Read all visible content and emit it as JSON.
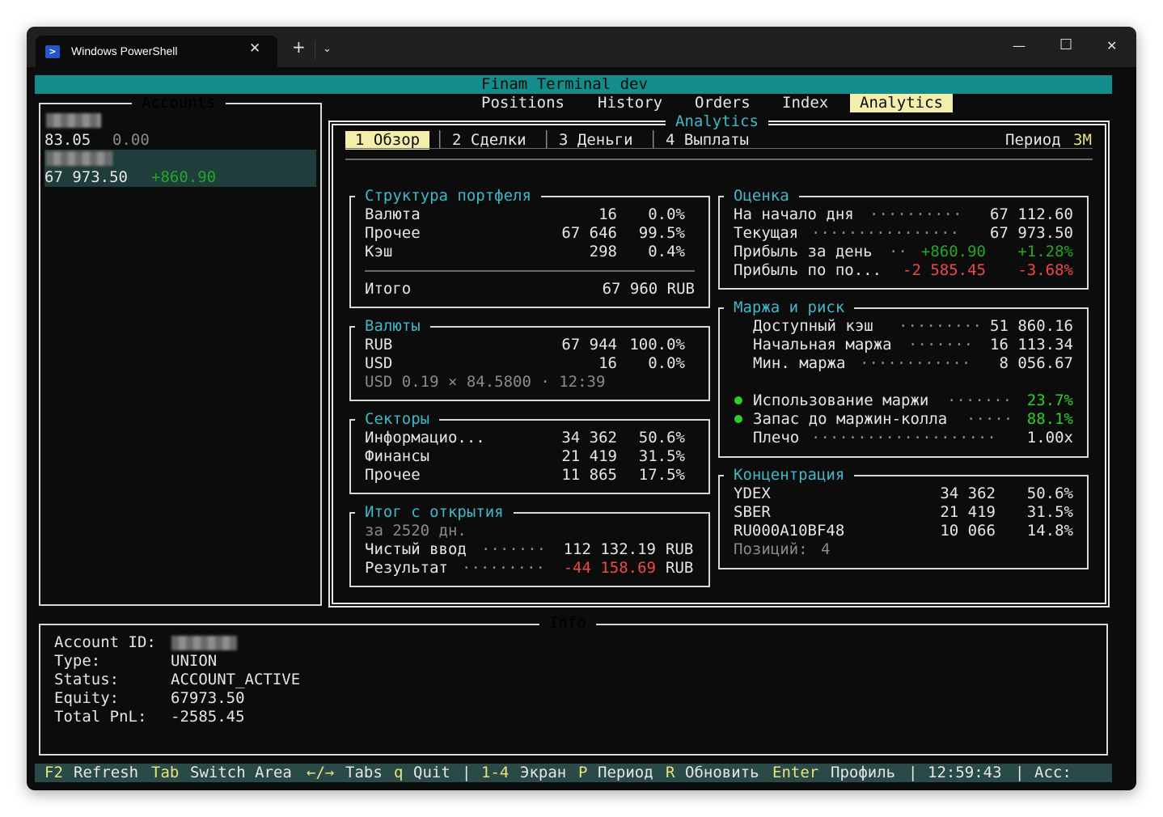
{
  "window": {
    "tab_title": "Windows PowerShell",
    "tab_icon": "powershell-icon",
    "controls": [
      "minimize-icon",
      "maximize-icon",
      "close-icon"
    ]
  },
  "app": {
    "title": "Finam Terminal dev",
    "nav_tabs": [
      "Positions",
      "History",
      "Orders",
      "Index",
      "Analytics"
    ],
    "active_nav": "Analytics"
  },
  "accounts": {
    "title": "Accounts",
    "items": [
      {
        "balance": "83.05",
        "pnl": "0.00"
      },
      {
        "balance": "67 973.50",
        "pnl": "+860.90"
      }
    ]
  },
  "analytics": {
    "title": "Analytics",
    "subtabs": [
      "1 Обзор",
      "2 Сделки",
      "3 Деньги",
      "4 Выплаты"
    ],
    "period_label": "Период",
    "period_value": "3M",
    "structure": {
      "title": "Структура портфеля",
      "rows": [
        {
          "name": "Валюта",
          "value": "16",
          "pct": "0.0%"
        },
        {
          "name": "Прочее",
          "value": "67 646",
          "pct": "99.5%"
        },
        {
          "name": "Кэш",
          "value": "298",
          "pct": "0.4%"
        }
      ],
      "total_label": "Итого",
      "total_value": "67 960 RUB"
    },
    "currencies": {
      "title": "Валюты",
      "rows": [
        {
          "name": "RUB",
          "value": "67 944",
          "pct": "100.0%"
        },
        {
          "name": "USD",
          "value": "16",
          "pct": "0.0%"
        }
      ],
      "note": "USD 0.19 × 84.5800 · 12:39"
    },
    "sectors": {
      "title": "Секторы",
      "rows": [
        {
          "name": "Информацио...",
          "value": "34 362",
          "pct": "50.6%"
        },
        {
          "name": "Финансы",
          "value": "21 419",
          "pct": "31.5%"
        },
        {
          "name": "Прочее",
          "value": "11 865",
          "pct": "17.5%"
        }
      ]
    },
    "since_open": {
      "title": "Итог с открытия",
      "period": "за 2520 дн.",
      "net_input_label": "Чистый ввод",
      "net_input_value": "112 132.19",
      "result_label": "Результат",
      "result_value": "-44 158.69",
      "currency": "RUB"
    },
    "valuation": {
      "title": "Оценка",
      "day_start_label": "На начало дня",
      "day_start_value": "67 112.60",
      "current_label": "Текущая",
      "current_value": "67 973.50",
      "day_profit_label": "Прибыль за день",
      "day_profit_value": "+860.90",
      "day_profit_pct": "+1.28%",
      "period_profit_label": "Прибыль по по...",
      "period_profit_value": "-2 585.45",
      "period_profit_pct": "-3.68%"
    },
    "margin": {
      "title": "Маржа и риск",
      "available_label": "Доступный кэш",
      "available_value": "51 860.16",
      "initial_label": "Начальная маржа",
      "initial_value": "16 113.34",
      "min_label": "Мин. маржа",
      "min_value": "8 056.67",
      "usage_label": "Использование маржи",
      "usage_value": "23.7%",
      "reserve_label": "Запас до маржин-колла",
      "reserve_value": "88.1%",
      "leverage_label": "Плечо",
      "leverage_value": "1.00x"
    },
    "concentration": {
      "title": "Концентрация",
      "rows": [
        {
          "name": "YDEX",
          "value": "34 362",
          "pct": "50.6%"
        },
        {
          "name": "SBER",
          "value": "21 419",
          "pct": "31.5%"
        },
        {
          "name": "RU000A10BF48",
          "value": "10 066",
          "pct": "14.8%"
        }
      ],
      "positions_label": "Позиций:",
      "positions_value": "4"
    }
  },
  "info": {
    "title": "Info",
    "account_id_label": "Account ID:",
    "type_label": "Type:",
    "type_value": "UNION",
    "status_label": "Status:",
    "status_value": "ACCOUNT_ACTIVE",
    "equity_label": "Equity:",
    "equity_value": "67973.50",
    "pnl_label": "Total PnL:",
    "pnl_value": "-2585.45"
  },
  "statusbar": {
    "items": [
      {
        "key": "F2",
        "label": "Refresh"
      },
      {
        "key": "Tab",
        "label": "Switch Area"
      },
      {
        "key": "←/→",
        "label": "Tabs"
      },
      {
        "key": "q",
        "label": "Quit"
      },
      {
        "key": "|",
        "label": ""
      },
      {
        "key": "1-4",
        "label": "Экран"
      },
      {
        "key": "P",
        "label": "Период"
      },
      {
        "key": "R",
        "label": "Обновить"
      },
      {
        "key": "Enter",
        "label": "Профиль"
      }
    ],
    "time": "12:59:43",
    "acc_label": "Acc:"
  },
  "colors": {
    "header_bg": "#138c8c",
    "accent_cyan": "#3fb8c8",
    "profit_green": "#2bd12b",
    "loss_red": "#f04848",
    "active_tab_bg": "#f3eeac",
    "selected_row_bg": "#1f3d3a",
    "status_bg": "#2a4a48",
    "key_yellow": "#e8e47a"
  }
}
